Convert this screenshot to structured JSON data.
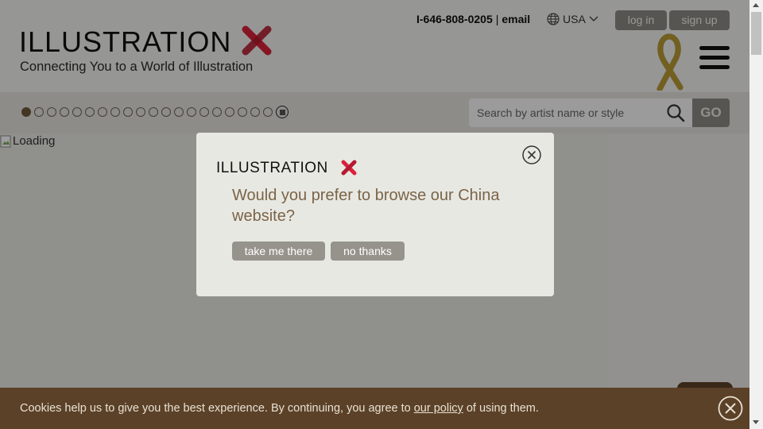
{
  "header": {
    "logo_text": "ILLUSTRATION",
    "tagline": "Connecting You to a World of Illustration",
    "phone": "I-646-808-0205",
    "separator": "|",
    "email": "email",
    "locale": "USA",
    "login": "log in",
    "signup": "sign up"
  },
  "slider": {
    "dot_count": 20,
    "active_index": 0
  },
  "search": {
    "placeholder": "Search by artist name or style",
    "go": "GO"
  },
  "main": {
    "loading_alt": "Loading"
  },
  "modal": {
    "logo_text": "ILLUSTRATION",
    "question": "Would you prefer to browse our China website?",
    "take_me_there": "take me there",
    "no_thanks": "no thanks"
  },
  "cookie": {
    "text_before": "Cookies help us to give you the best experience. By continuing, you agree to ",
    "link": "our policy",
    "text_after": " of using them."
  },
  "colors": {
    "accent_red": "#d9223a",
    "cookie_bg": "#5b4128",
    "button_gray": "#8d8a83",
    "question_brown": "#7b6447"
  }
}
